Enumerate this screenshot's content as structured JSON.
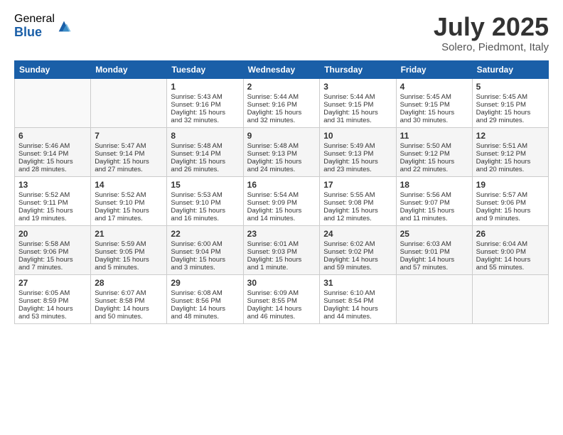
{
  "logo": {
    "general": "General",
    "blue": "Blue"
  },
  "header": {
    "month": "July 2025",
    "location": "Solero, Piedmont, Italy"
  },
  "weekdays": [
    "Sunday",
    "Monday",
    "Tuesday",
    "Wednesday",
    "Thursday",
    "Friday",
    "Saturday"
  ],
  "weeks": [
    [
      {
        "day": "",
        "info": ""
      },
      {
        "day": "",
        "info": ""
      },
      {
        "day": "1",
        "info": "Sunrise: 5:43 AM\nSunset: 9:16 PM\nDaylight: 15 hours\nand 32 minutes."
      },
      {
        "day": "2",
        "info": "Sunrise: 5:44 AM\nSunset: 9:16 PM\nDaylight: 15 hours\nand 32 minutes."
      },
      {
        "day": "3",
        "info": "Sunrise: 5:44 AM\nSunset: 9:15 PM\nDaylight: 15 hours\nand 31 minutes."
      },
      {
        "day": "4",
        "info": "Sunrise: 5:45 AM\nSunset: 9:15 PM\nDaylight: 15 hours\nand 30 minutes."
      },
      {
        "day": "5",
        "info": "Sunrise: 5:45 AM\nSunset: 9:15 PM\nDaylight: 15 hours\nand 29 minutes."
      }
    ],
    [
      {
        "day": "6",
        "info": "Sunrise: 5:46 AM\nSunset: 9:14 PM\nDaylight: 15 hours\nand 28 minutes."
      },
      {
        "day": "7",
        "info": "Sunrise: 5:47 AM\nSunset: 9:14 PM\nDaylight: 15 hours\nand 27 minutes."
      },
      {
        "day": "8",
        "info": "Sunrise: 5:48 AM\nSunset: 9:14 PM\nDaylight: 15 hours\nand 26 minutes."
      },
      {
        "day": "9",
        "info": "Sunrise: 5:48 AM\nSunset: 9:13 PM\nDaylight: 15 hours\nand 24 minutes."
      },
      {
        "day": "10",
        "info": "Sunrise: 5:49 AM\nSunset: 9:13 PM\nDaylight: 15 hours\nand 23 minutes."
      },
      {
        "day": "11",
        "info": "Sunrise: 5:50 AM\nSunset: 9:12 PM\nDaylight: 15 hours\nand 22 minutes."
      },
      {
        "day": "12",
        "info": "Sunrise: 5:51 AM\nSunset: 9:12 PM\nDaylight: 15 hours\nand 20 minutes."
      }
    ],
    [
      {
        "day": "13",
        "info": "Sunrise: 5:52 AM\nSunset: 9:11 PM\nDaylight: 15 hours\nand 19 minutes."
      },
      {
        "day": "14",
        "info": "Sunrise: 5:52 AM\nSunset: 9:10 PM\nDaylight: 15 hours\nand 17 minutes."
      },
      {
        "day": "15",
        "info": "Sunrise: 5:53 AM\nSunset: 9:10 PM\nDaylight: 15 hours\nand 16 minutes."
      },
      {
        "day": "16",
        "info": "Sunrise: 5:54 AM\nSunset: 9:09 PM\nDaylight: 15 hours\nand 14 minutes."
      },
      {
        "day": "17",
        "info": "Sunrise: 5:55 AM\nSunset: 9:08 PM\nDaylight: 15 hours\nand 12 minutes."
      },
      {
        "day": "18",
        "info": "Sunrise: 5:56 AM\nSunset: 9:07 PM\nDaylight: 15 hours\nand 11 minutes."
      },
      {
        "day": "19",
        "info": "Sunrise: 5:57 AM\nSunset: 9:06 PM\nDaylight: 15 hours\nand 9 minutes."
      }
    ],
    [
      {
        "day": "20",
        "info": "Sunrise: 5:58 AM\nSunset: 9:06 PM\nDaylight: 15 hours\nand 7 minutes."
      },
      {
        "day": "21",
        "info": "Sunrise: 5:59 AM\nSunset: 9:05 PM\nDaylight: 15 hours\nand 5 minutes."
      },
      {
        "day": "22",
        "info": "Sunrise: 6:00 AM\nSunset: 9:04 PM\nDaylight: 15 hours\nand 3 minutes."
      },
      {
        "day": "23",
        "info": "Sunrise: 6:01 AM\nSunset: 9:03 PM\nDaylight: 15 hours\nand 1 minute."
      },
      {
        "day": "24",
        "info": "Sunrise: 6:02 AM\nSunset: 9:02 PM\nDaylight: 14 hours\nand 59 minutes."
      },
      {
        "day": "25",
        "info": "Sunrise: 6:03 AM\nSunset: 9:01 PM\nDaylight: 14 hours\nand 57 minutes."
      },
      {
        "day": "26",
        "info": "Sunrise: 6:04 AM\nSunset: 9:00 PM\nDaylight: 14 hours\nand 55 minutes."
      }
    ],
    [
      {
        "day": "27",
        "info": "Sunrise: 6:05 AM\nSunset: 8:59 PM\nDaylight: 14 hours\nand 53 minutes."
      },
      {
        "day": "28",
        "info": "Sunrise: 6:07 AM\nSunset: 8:58 PM\nDaylight: 14 hours\nand 50 minutes."
      },
      {
        "day": "29",
        "info": "Sunrise: 6:08 AM\nSunset: 8:56 PM\nDaylight: 14 hours\nand 48 minutes."
      },
      {
        "day": "30",
        "info": "Sunrise: 6:09 AM\nSunset: 8:55 PM\nDaylight: 14 hours\nand 46 minutes."
      },
      {
        "day": "31",
        "info": "Sunrise: 6:10 AM\nSunset: 8:54 PM\nDaylight: 14 hours\nand 44 minutes."
      },
      {
        "day": "",
        "info": ""
      },
      {
        "day": "",
        "info": ""
      }
    ]
  ]
}
